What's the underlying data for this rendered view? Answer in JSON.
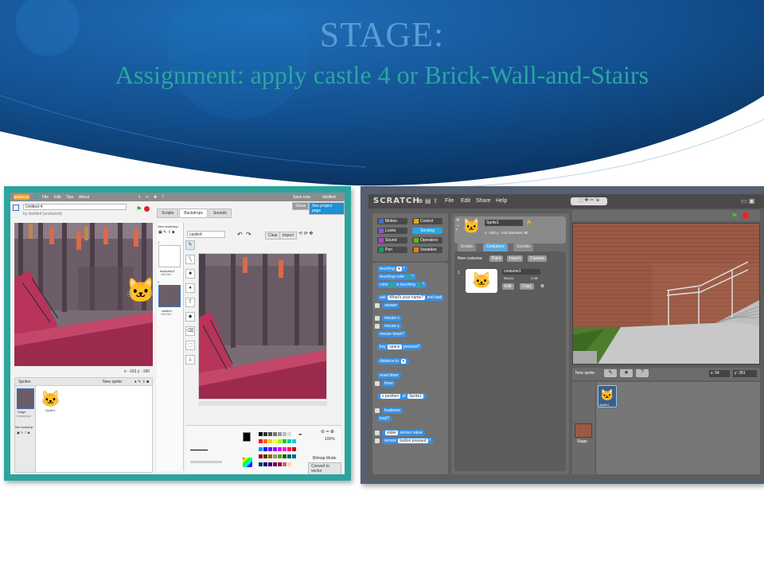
{
  "slide": {
    "title": "STAGE:",
    "subtitle": "Assignment:  apply castle 4 or Brick-Wall-and-Stairs"
  },
  "left_screenshot": {
    "logo": "SCRATCH",
    "menu": [
      "File",
      "Edit",
      "Tips",
      "About"
    ],
    "save_label": "Save now",
    "user": "distilled",
    "project_title": "Untitled-4",
    "project_owner": "by distilled (unshared)",
    "share_label": "Share",
    "see_project_label": "See project page",
    "tabs": [
      "Scripts",
      "Backdrops",
      "Sounds"
    ],
    "new_backdrop_label": "New backdrop:",
    "backdrops": [
      {
        "index": "1",
        "name": "backdrop1",
        "size": "480x360"
      },
      {
        "index": "2",
        "name": "castle4",
        "size": "480x360"
      }
    ],
    "costume_name_value": "castle4",
    "clear_label": "Clear",
    "import_label": "Import",
    "coords": "x: -163   y: -180",
    "sprites_header": "Sprites",
    "new_sprite_label": "New sprite:",
    "stage_thumb_label": "Stage",
    "stage_thumb_sub": "2 backdrops",
    "sprite1_label": "Sprite1",
    "new_backdrop_small": "New backdrop:",
    "zoom": "100%",
    "mode_label": "Bitmap Mode",
    "convert_label": "Convert to vector"
  },
  "right_screenshot": {
    "logo": "SCRATCH",
    "menu": [
      "File",
      "Edit",
      "Share",
      "Help"
    ],
    "categories": [
      {
        "label": "Motion",
        "color": "#4a6cd4"
      },
      {
        "label": "Control",
        "color": "#e1a91a"
      },
      {
        "label": "Looks",
        "color": "#8a55d7"
      },
      {
        "label": "Sensing",
        "color": "#2ca5e2"
      },
      {
        "label": "Sound",
        "color": "#bb42c3"
      },
      {
        "label": "Operators",
        "color": "#5cb712"
      },
      {
        "label": "Pen",
        "color": "#0e9a6c"
      },
      {
        "label": "Variables",
        "color": "#ee7d16"
      }
    ],
    "blocks": {
      "touching": "touching",
      "touching_color": "touching color",
      "color": "color",
      "is_touching": "is touching",
      "ask": "ask",
      "ask_value": "What's your name?",
      "and_wait": "and wait",
      "answer": "answer",
      "mouse_x": "mouse x",
      "mouse_y": "mouse y",
      "mouse_down": "mouse down?",
      "key": "key",
      "key_value": "space",
      "pressed": "pressed?",
      "distance_to": "distance to",
      "reset_timer": "reset timer",
      "timer": "timer",
      "x_position": "x position",
      "of": "of",
      "of_value": "Sprite1",
      "loudness": "loudness",
      "loud": "loud?",
      "slider": "slider",
      "sensor_value": "sensor value",
      "sensor": "sensor",
      "button_pressed": "button pressed"
    },
    "sprite_name": "Sprite1",
    "sprite_pos": "x: -240  y: -210  direction: 90",
    "tabs": [
      "Scripts",
      "Costumes",
      "Sounds"
    ],
    "new_costume_label": "New costume:",
    "paint_label": "Paint",
    "import_label": "Import",
    "camera_label": "Camera",
    "costume_index": "1",
    "costume_name": "costume1",
    "costume_size": "95x111",
    "costume_kb": "3 KB",
    "edit_label": "Edit",
    "copy_label": "Copy",
    "new_sprite_label": "New sprite:",
    "mouse_x_readout": "x: 94",
    "mouse_y_readout": "y: 281",
    "sprite_thumb_label": "Sprite1",
    "stage_label": "Stage"
  }
}
